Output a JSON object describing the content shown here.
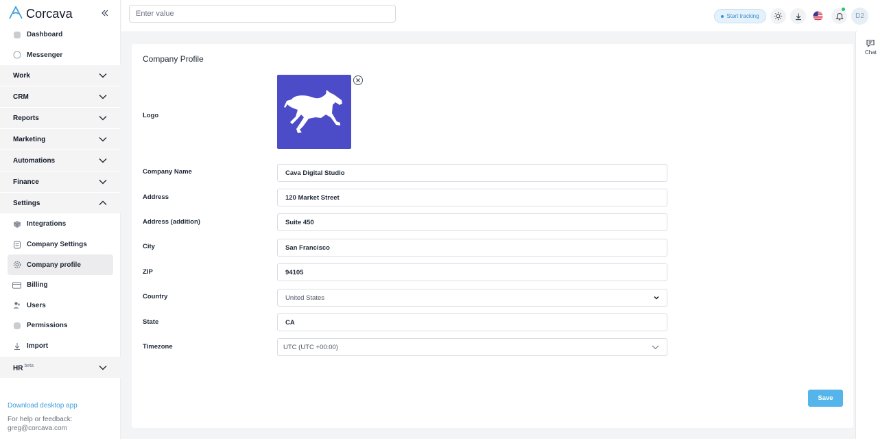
{
  "brand": {
    "name": "Corcava",
    "accent": "#3b9ddd"
  },
  "sidebar": {
    "top_items": [
      {
        "label": "Dashboard",
        "icon": "dashboard-icon"
      },
      {
        "label": "Messenger",
        "icon": "messenger-icon"
      }
    ],
    "groups": [
      {
        "label": "Work",
        "expanded": false
      },
      {
        "label": "CRM",
        "expanded": false
      },
      {
        "label": "Reports",
        "expanded": false
      },
      {
        "label": "Marketing",
        "expanded": false
      },
      {
        "label": "Automations",
        "expanded": false
      },
      {
        "label": "Finance",
        "expanded": false
      },
      {
        "label": "Settings",
        "expanded": true
      }
    ],
    "settings_items": [
      {
        "label": "Integrations",
        "icon": "cube-icon",
        "active": false
      },
      {
        "label": "Company Settings",
        "icon": "document-icon",
        "active": false
      },
      {
        "label": "Company profile",
        "icon": "gear-icon",
        "active": true
      },
      {
        "label": "Billing",
        "icon": "credit-card-icon",
        "active": false
      },
      {
        "label": "Users",
        "icon": "users-icon",
        "active": false
      },
      {
        "label": "Permissions",
        "icon": "shield-icon",
        "active": false
      },
      {
        "label": "Import",
        "icon": "import-icon",
        "active": false
      }
    ],
    "hr": {
      "label": "HR",
      "badge": "beta"
    },
    "download_label": "Download desktop app",
    "help_label": "For help or feedback:",
    "help_email": "greg@corcava.com"
  },
  "topbar": {
    "search_placeholder": "Enter value",
    "tracking_label": "Start tracking",
    "avatar_initials": "D2"
  },
  "chat": {
    "label": "Chat"
  },
  "form": {
    "title": "Company Profile",
    "logo_label": "Logo",
    "logo_color": "#4c4bc8",
    "fields": {
      "company_name": {
        "label": "Company Name",
        "value": "Cava Digital Studio"
      },
      "address": {
        "label": "Address",
        "value": "120 Market Street"
      },
      "address2": {
        "label": "Address (addition)",
        "value": "Suite 450"
      },
      "city": {
        "label": "City",
        "value": "San Francisco"
      },
      "zip": {
        "label": "ZIP",
        "value": "94105"
      },
      "country": {
        "label": "Country",
        "value": "United States"
      },
      "state": {
        "label": "State",
        "value": "CA"
      },
      "timezone": {
        "label": "Timezone",
        "value": "UTC (UTC +00:00)"
      }
    },
    "save_label": "Save",
    "save_color": "#55b5ea"
  }
}
